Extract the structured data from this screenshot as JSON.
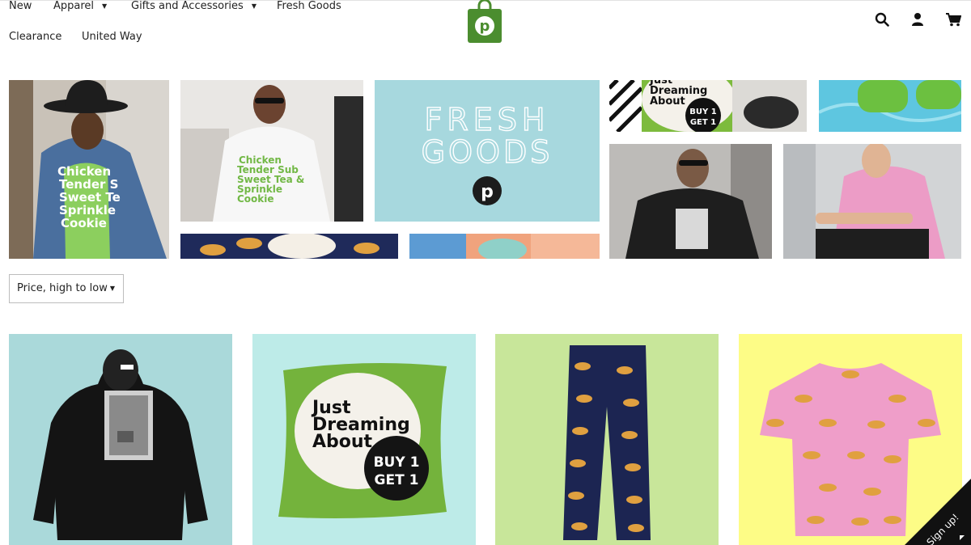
{
  "nav": {
    "new": "New",
    "apparel": "Apparel",
    "gifts": "Gifts and Accessories",
    "fresh_goods": "Fresh Goods",
    "clearance": "Clearance",
    "united_way": "United Way"
  },
  "brand": {
    "logo_letter": "p",
    "color": "#4b8d2f"
  },
  "hero": {
    "fresh_line1": "FRESH",
    "fresh_line2": "GOODS",
    "fresh_logo_letter": "p",
    "shirt_lines": [
      "Chicken",
      "Tender S",
      "Sweet Te",
      "Sprinkle",
      "Cookie"
    ],
    "hoodie_lines": [
      "Chicken",
      "Tender Sub",
      "Sweet Tea &",
      "Sprinkle",
      "Cookie"
    ],
    "dream_lines": [
      "Just",
      "Dreaming",
      "About"
    ],
    "dream_badge": [
      "BUY 1",
      "GET 1"
    ]
  },
  "sort": {
    "label": "Price, high to low"
  },
  "products": {
    "pillow_lines": [
      "Just",
      "Dreaming",
      "About"
    ],
    "pillow_badge": [
      "BUY 1",
      "GET 1"
    ]
  },
  "signup": {
    "label": "Sign up!"
  },
  "colors": {
    "green": "#6ab23f",
    "teal_bg": "#a8d7dd",
    "pink": "#ee9dc8"
  }
}
